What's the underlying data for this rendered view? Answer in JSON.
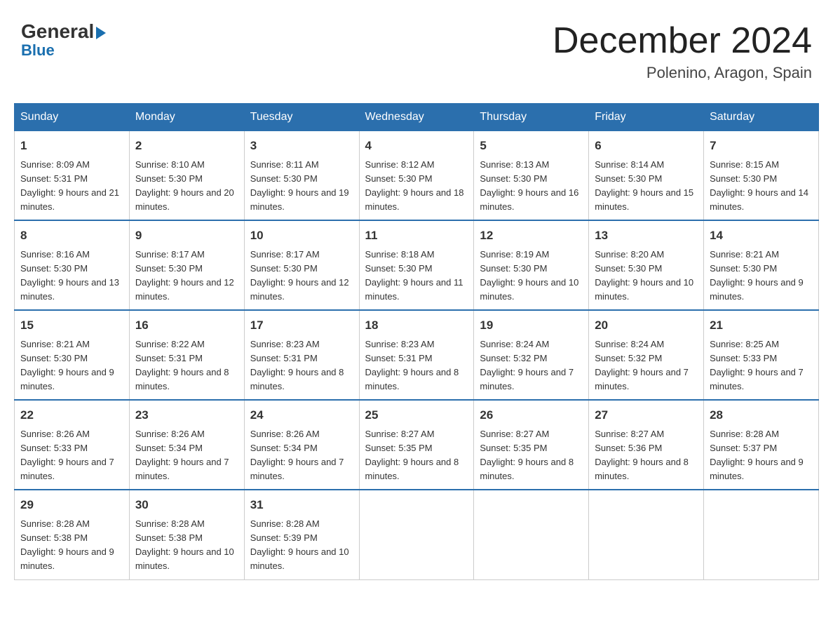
{
  "header": {
    "logo_general": "General",
    "logo_blue": "Blue",
    "month_title": "December 2024",
    "location": "Polenino, Aragon, Spain"
  },
  "days_of_week": [
    "Sunday",
    "Monday",
    "Tuesday",
    "Wednesday",
    "Thursday",
    "Friday",
    "Saturday"
  ],
  "weeks": [
    [
      {
        "day": "1",
        "sunrise": "8:09 AM",
        "sunset": "5:31 PM",
        "daylight": "9 hours and 21 minutes."
      },
      {
        "day": "2",
        "sunrise": "8:10 AM",
        "sunset": "5:30 PM",
        "daylight": "9 hours and 20 minutes."
      },
      {
        "day": "3",
        "sunrise": "8:11 AM",
        "sunset": "5:30 PM",
        "daylight": "9 hours and 19 minutes."
      },
      {
        "day": "4",
        "sunrise": "8:12 AM",
        "sunset": "5:30 PM",
        "daylight": "9 hours and 18 minutes."
      },
      {
        "day": "5",
        "sunrise": "8:13 AM",
        "sunset": "5:30 PM",
        "daylight": "9 hours and 16 minutes."
      },
      {
        "day": "6",
        "sunrise": "8:14 AM",
        "sunset": "5:30 PM",
        "daylight": "9 hours and 15 minutes."
      },
      {
        "day": "7",
        "sunrise": "8:15 AM",
        "sunset": "5:30 PM",
        "daylight": "9 hours and 14 minutes."
      }
    ],
    [
      {
        "day": "8",
        "sunrise": "8:16 AM",
        "sunset": "5:30 PM",
        "daylight": "9 hours and 13 minutes."
      },
      {
        "day": "9",
        "sunrise": "8:17 AM",
        "sunset": "5:30 PM",
        "daylight": "9 hours and 12 minutes."
      },
      {
        "day": "10",
        "sunrise": "8:17 AM",
        "sunset": "5:30 PM",
        "daylight": "9 hours and 12 minutes."
      },
      {
        "day": "11",
        "sunrise": "8:18 AM",
        "sunset": "5:30 PM",
        "daylight": "9 hours and 11 minutes."
      },
      {
        "day": "12",
        "sunrise": "8:19 AM",
        "sunset": "5:30 PM",
        "daylight": "9 hours and 10 minutes."
      },
      {
        "day": "13",
        "sunrise": "8:20 AM",
        "sunset": "5:30 PM",
        "daylight": "9 hours and 10 minutes."
      },
      {
        "day": "14",
        "sunrise": "8:21 AM",
        "sunset": "5:30 PM",
        "daylight": "9 hours and 9 minutes."
      }
    ],
    [
      {
        "day": "15",
        "sunrise": "8:21 AM",
        "sunset": "5:30 PM",
        "daylight": "9 hours and 9 minutes."
      },
      {
        "day": "16",
        "sunrise": "8:22 AM",
        "sunset": "5:31 PM",
        "daylight": "9 hours and 8 minutes."
      },
      {
        "day": "17",
        "sunrise": "8:23 AM",
        "sunset": "5:31 PM",
        "daylight": "9 hours and 8 minutes."
      },
      {
        "day": "18",
        "sunrise": "8:23 AM",
        "sunset": "5:31 PM",
        "daylight": "9 hours and 8 minutes."
      },
      {
        "day": "19",
        "sunrise": "8:24 AM",
        "sunset": "5:32 PM",
        "daylight": "9 hours and 7 minutes."
      },
      {
        "day": "20",
        "sunrise": "8:24 AM",
        "sunset": "5:32 PM",
        "daylight": "9 hours and 7 minutes."
      },
      {
        "day": "21",
        "sunrise": "8:25 AM",
        "sunset": "5:33 PM",
        "daylight": "9 hours and 7 minutes."
      }
    ],
    [
      {
        "day": "22",
        "sunrise": "8:26 AM",
        "sunset": "5:33 PM",
        "daylight": "9 hours and 7 minutes."
      },
      {
        "day": "23",
        "sunrise": "8:26 AM",
        "sunset": "5:34 PM",
        "daylight": "9 hours and 7 minutes."
      },
      {
        "day": "24",
        "sunrise": "8:26 AM",
        "sunset": "5:34 PM",
        "daylight": "9 hours and 7 minutes."
      },
      {
        "day": "25",
        "sunrise": "8:27 AM",
        "sunset": "5:35 PM",
        "daylight": "9 hours and 8 minutes."
      },
      {
        "day": "26",
        "sunrise": "8:27 AM",
        "sunset": "5:35 PM",
        "daylight": "9 hours and 8 minutes."
      },
      {
        "day": "27",
        "sunrise": "8:27 AM",
        "sunset": "5:36 PM",
        "daylight": "9 hours and 8 minutes."
      },
      {
        "day": "28",
        "sunrise": "8:28 AM",
        "sunset": "5:37 PM",
        "daylight": "9 hours and 9 minutes."
      }
    ],
    [
      {
        "day": "29",
        "sunrise": "8:28 AM",
        "sunset": "5:38 PM",
        "daylight": "9 hours and 9 minutes."
      },
      {
        "day": "30",
        "sunrise": "8:28 AM",
        "sunset": "5:38 PM",
        "daylight": "9 hours and 10 minutes."
      },
      {
        "day": "31",
        "sunrise": "8:28 AM",
        "sunset": "5:39 PM",
        "daylight": "9 hours and 10 minutes."
      },
      null,
      null,
      null,
      null
    ]
  ]
}
